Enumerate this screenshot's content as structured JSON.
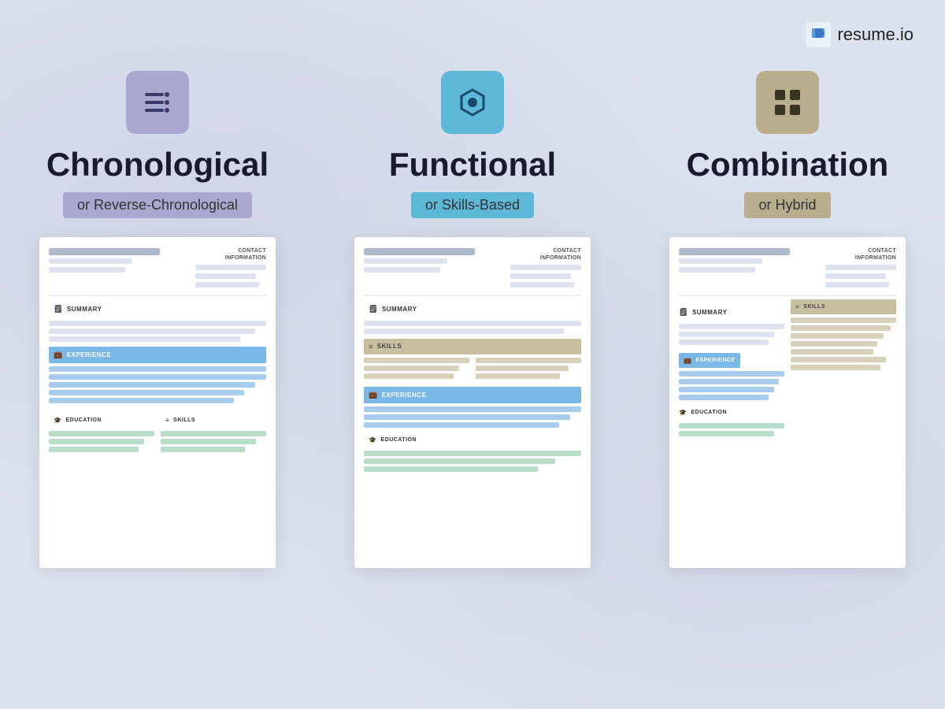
{
  "logo": {
    "text": "resume.io"
  },
  "columns": [
    {
      "id": "chronological",
      "icon_type": "list",
      "icon_color": "purple",
      "title": "Chronological",
      "subtitle": "or Reverse-Chronological",
      "subtitle_color": "purple",
      "sections": [
        "SUMMARY",
        "EXPERIENCE",
        "EDUCATION",
        "SKILLS"
      ]
    },
    {
      "id": "functional",
      "icon_type": "hexagon",
      "icon_color": "blue",
      "title": "Functional",
      "subtitle": "or Skills-Based",
      "subtitle_color": "blue",
      "sections": [
        "SUMMARY",
        "SKILLS",
        "EXPERIENCE",
        "EDUCATION"
      ]
    },
    {
      "id": "combination",
      "icon_type": "grid",
      "icon_color": "tan",
      "title": "Combination",
      "subtitle": "or Hybrid",
      "subtitle_color": "tan",
      "sections": [
        "SUMMARY",
        "SKILLS",
        "EXPERIENCE",
        "EDUCATION"
      ]
    }
  ],
  "contact_label": "CONTACT\nINFORMATION",
  "section_labels": {
    "summary": "SUMMARY",
    "experience": "EXPERIENCE",
    "education": "EDUCATION",
    "skills": "SKILLS"
  }
}
